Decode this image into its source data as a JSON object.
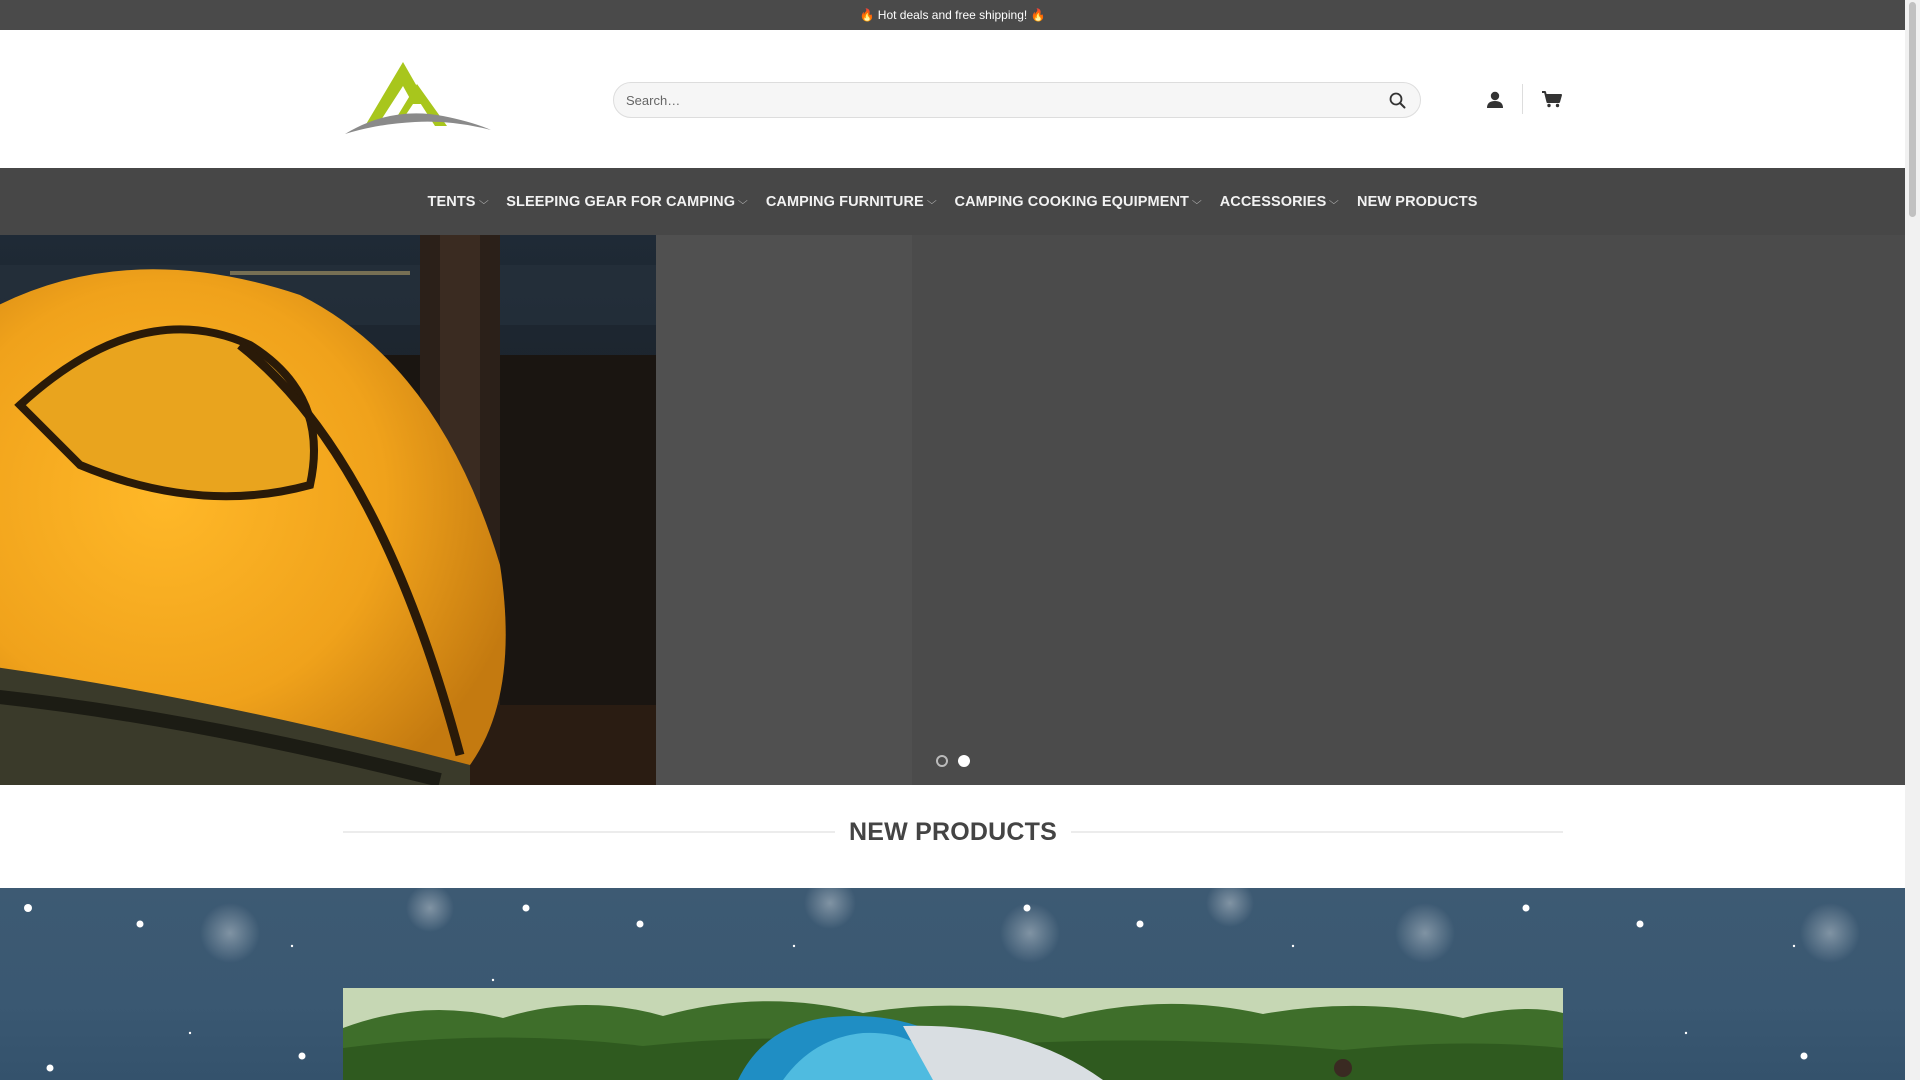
{
  "topbar": {
    "text": "🔥 Hot deals and free shipping! 🔥"
  },
  "header": {
    "logo_name": "mountain-logo",
    "search": {
      "placeholder": "Search…",
      "value": ""
    },
    "icons": {
      "search": "search-icon",
      "account": "user-icon",
      "cart": "cart-icon"
    }
  },
  "nav": {
    "items": [
      {
        "label": "TENTS",
        "has_dropdown": true
      },
      {
        "label": "SLEEPING GEAR FOR CAMPING",
        "has_dropdown": true
      },
      {
        "label": "CAMPING FURNITURE",
        "has_dropdown": true
      },
      {
        "label": "CAMPING COOKING EQUIPMENT",
        "has_dropdown": true
      },
      {
        "label": "ACCESSORIES",
        "has_dropdown": true
      },
      {
        "label": "NEW PRODUCTS",
        "has_dropdown": false
      }
    ],
    "dropdown_icon": "chevron-down-icon"
  },
  "hero": {
    "slides": 2,
    "active_slide": 2
  },
  "section": {
    "title": "NEW PRODUCTS"
  },
  "colors": {
    "topbar": "#4a4a4a",
    "nav": "#474747",
    "logo_green": "#a8c61c",
    "logo_gray": "#8a8a8a",
    "hero_bg": "#4b4b4b"
  }
}
